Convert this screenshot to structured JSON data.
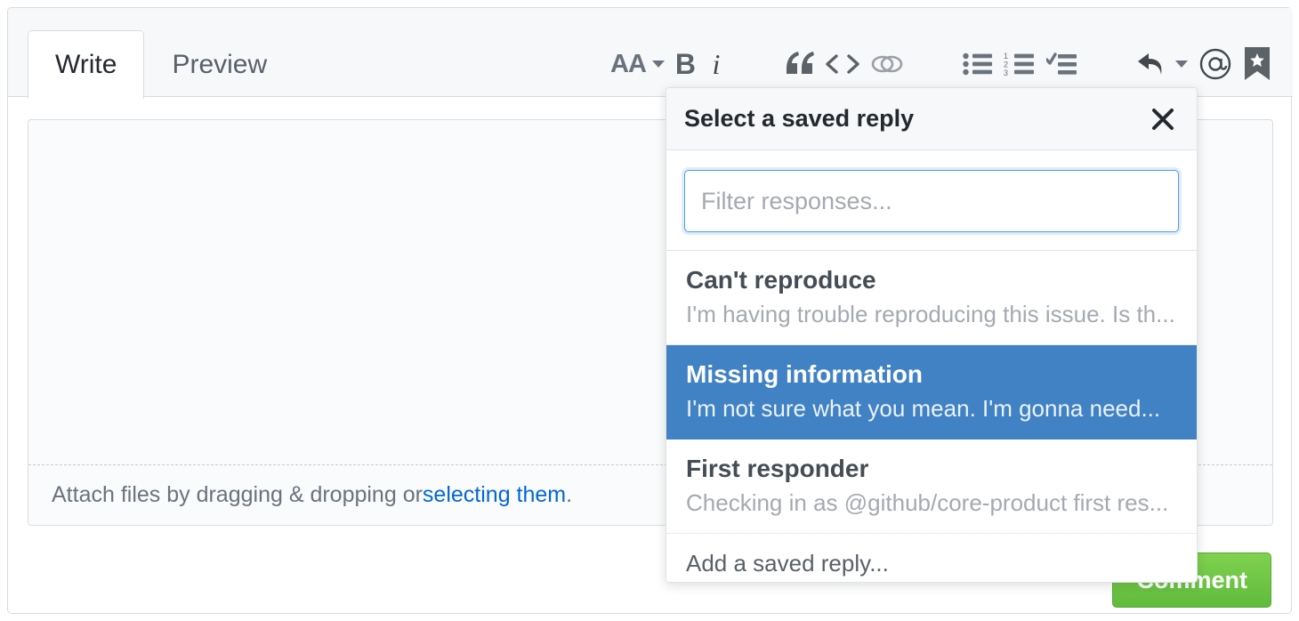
{
  "editor": {
    "tabs": [
      {
        "label": "Write",
        "selected": true
      },
      {
        "label": "Preview",
        "selected": false
      }
    ],
    "textarea_value": "",
    "attach_text_before": "Attach files by dragging & dropping or ",
    "attach_link": "selecting them",
    "attach_text_after": ".",
    "submit_label": "Comment"
  },
  "toolbar": {
    "heading_label": "AA",
    "bold_label": "B",
    "italic_label": "i",
    "quote_label": "“",
    "items": [
      "heading-icon",
      "bold-icon",
      "italic-icon",
      "quote-icon",
      "code-icon",
      "link-icon",
      "unordered-list-icon",
      "ordered-list-icon",
      "task-list-icon",
      "reply-icon",
      "mention-icon",
      "saved-reply-icon"
    ]
  },
  "saved_reply_menu": {
    "title": "Select a saved reply",
    "close_label": "×",
    "filter_placeholder": "Filter responses...",
    "filter_value": "",
    "items": [
      {
        "title": "Can't reproduce",
        "desc": "I'm having trouble reproducing this issue. Is th...",
        "selected": false
      },
      {
        "title": "Missing information",
        "desc": "I'm not sure what you mean. I'm gonna need...",
        "selected": true
      },
      {
        "title": "First responder",
        "desc": "Checking in as @github/core-product first res...",
        "selected": false
      }
    ],
    "footer_label": "Add a saved reply..."
  },
  "colors": {
    "selected_blue": "#4182c4",
    "submit_green": "#6cc644",
    "link_blue": "#0366d6",
    "focus_border": "#4a9fe8"
  }
}
